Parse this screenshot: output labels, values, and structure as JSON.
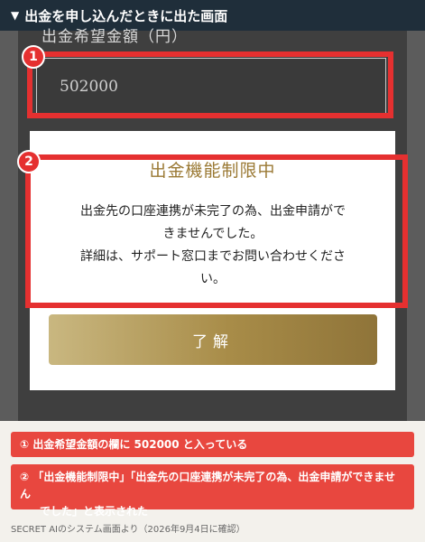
{
  "header": {
    "title": "出金を申し込んだときに出た画面"
  },
  "form": {
    "field_label": "出金希望金額（円）",
    "amount_value": "502000"
  },
  "dialog": {
    "title": "出金機能制限中",
    "message_line1": "出金先の口座連携が未完了の為、出金申請がで",
    "message_line2": "きませんでした。",
    "message_line3": "詳細は、サポート窓口までお問い合わせくださ",
    "message_line4": "い。",
    "ok_label": "了解"
  },
  "annotations": {
    "badge1": "1",
    "badge2": "2",
    "note1": "①  出金希望金額の欄に 502000 と入っている",
    "note2_line1": "②  「出金機能制限中」「出金先の口座連携が未完了の為、出金申請ができません",
    "note2_line2": "でした」と表示された",
    "highlight_color": "#e53030"
  },
  "footer": {
    "source": "SECRET AIのシステム画面より（2026年9月4日に確認）"
  }
}
